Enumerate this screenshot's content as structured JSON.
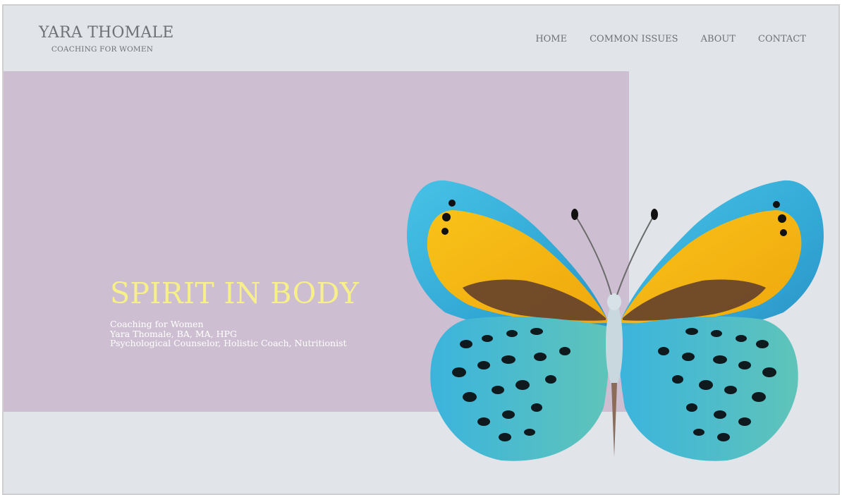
{
  "header": {
    "brand_name": "YARA THOMALE",
    "brand_tagline": "COACHING FOR WOMEN",
    "nav": [
      {
        "label": "HOME"
      },
      {
        "label": "COMMON ISSUES"
      },
      {
        "label": "ABOUT"
      },
      {
        "label": "CONTACT"
      }
    ]
  },
  "hero": {
    "title": "SPIRIT IN BODY",
    "lines": [
      "Coaching for Women",
      "Yara Thomale, BA, MA, HPG",
      "Psychological Counselor, Holistic Coach, Nutritionist"
    ],
    "image": "butterfly-image"
  },
  "colors": {
    "page_background": "#e1e4e8",
    "hero_panel": "#cdbfd1",
    "title_yellow": "#f6ef8a",
    "text_gray": "#6f7174",
    "butterfly_blue": "#3cb6de",
    "butterfly_orange": "#f3b413"
  }
}
